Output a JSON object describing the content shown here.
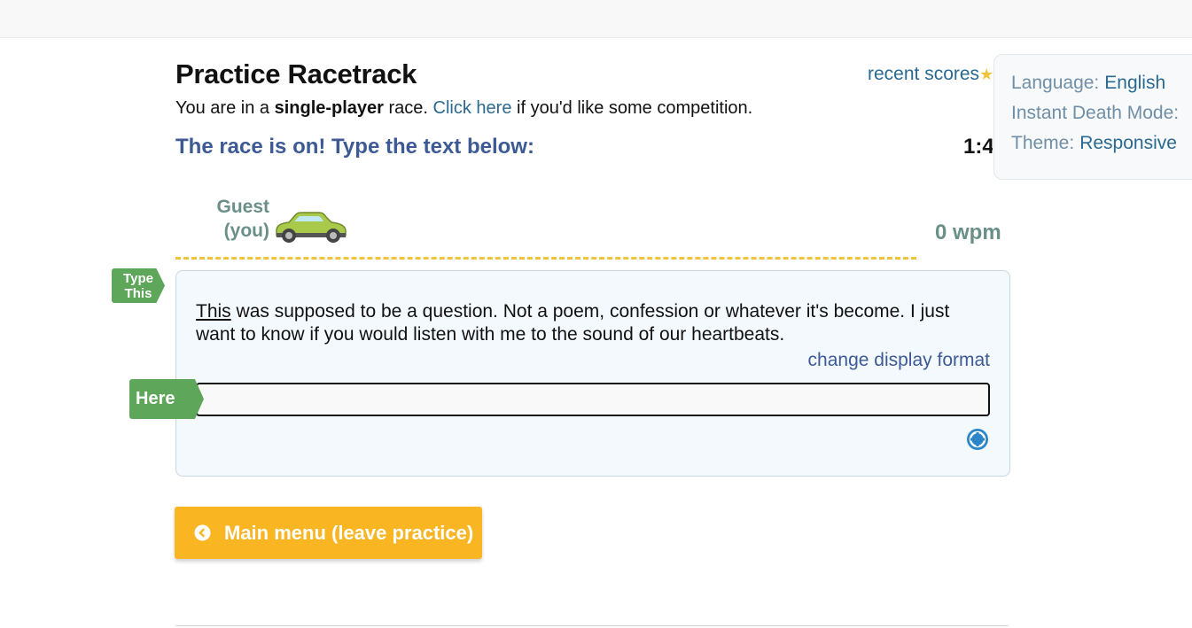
{
  "header": {
    "title": "Practice Racetrack",
    "recent_scores_label": "recent scores",
    "subline_prefix": "You are in a ",
    "subline_bold": "single-player",
    "subline_mid": " race. ",
    "subline_link": "Click here",
    "subline_suffix": " if you'd like some competition."
  },
  "race": {
    "status": "The race is on! Type the text below:",
    "timer": "1:4"
  },
  "settings": {
    "language_label": "Language:",
    "language_value": "English",
    "instant_death_label": "Instant Death Mode:",
    "theme_label": "Theme:",
    "theme_value": "Responsive"
  },
  "racer": {
    "name_line1": "Guest",
    "name_line2": "(you)",
    "wpm": "0 wpm",
    "car_color": "#a9c94a"
  },
  "panel": {
    "current_word": "This",
    "rest_text": " was supposed to be a question. Not a poem, confession or whatever it's become. I just want to know if you would listen with me to the sound of our heartbeats.",
    "change_format_label": "change display format",
    "input_value": "",
    "type_tag_line1": "Type",
    "type_tag_line2": "This",
    "here_tag": "Here"
  },
  "main_button": {
    "label": "Main menu (leave practice)"
  },
  "colors": {
    "accent_blue": "#3d5a94",
    "link_blue": "#2a6a91",
    "tag_green": "#5ea659",
    "button_orange": "#fab523",
    "track_yellow": "#f0c33c"
  }
}
